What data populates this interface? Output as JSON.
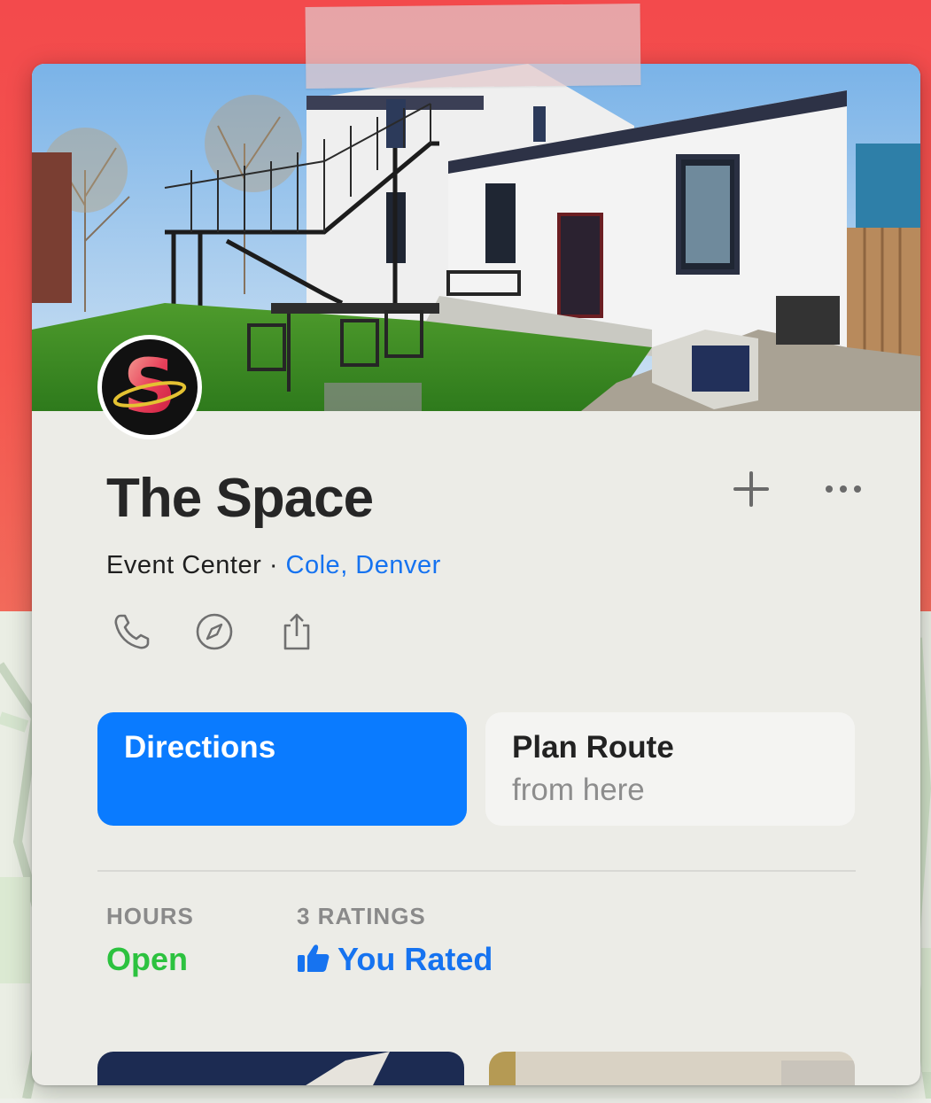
{
  "place": {
    "name": "The Space",
    "category": "Event Center",
    "separator": " · ",
    "location": "Cole, Denver"
  },
  "actions": {
    "directions_label": "Directions",
    "plan_route_line1": "Plan Route",
    "plan_route_line2": "from here"
  },
  "stats": {
    "hours_label": "HOURS",
    "hours_value": "Open",
    "ratings_label": "3 RATINGS",
    "ratings_value": "You Rated"
  },
  "icons": {
    "add": "plus-icon",
    "more": "ellipsis-icon",
    "call": "phone-icon",
    "website": "compass-icon",
    "share": "share-icon",
    "rated": "thumbs-up-icon"
  },
  "colors": {
    "accent": "#0a7bff",
    "link": "#1673f0",
    "open": "#2cc23f",
    "background_top": "#f34a4c"
  }
}
